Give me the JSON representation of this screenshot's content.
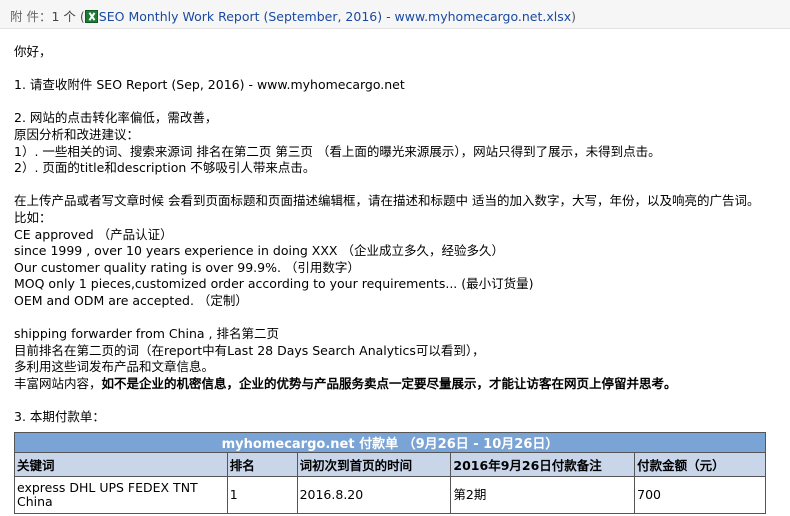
{
  "attachment": {
    "label": "附  件：",
    "count": "1 个",
    "open_paren": "(",
    "file_name": "SEO Monthly Work Report (September, 2016) - www.myhomecargo.net.xlsx",
    "close_paren": ")",
    "icon": "excel-icon"
  },
  "lines": [
    "你好，",
    "",
    "1. 请查收附件  SEO Report (Sep, 2016) - www.myhomecargo.net",
    "",
    "2.  网站的点击转化率偏低，需改善，",
    "原因分析和改进建议：",
    "1）.  一些相关的词、搜索来源词 排名在第二页 第三页 （看上面的曝光来源展示），网站只得到了展示，未得到点击。",
    "2）.  页面的title和description  不够吸引人带来点击。",
    "",
    "在上传产品或者写文章时候 会看到页面标题和页面描述编辑框，请在描述和标题中 适当的加入数字，大写，年份，以及响亮的广告词。",
    "比如：",
    "CE approved （产品认证）",
    "since 1999 , over 10 years experience in doing XXX （企业成立多久，经验多久）",
    "Our customer quality rating is over 99.9%.  （引用数字）",
    "MOQ only 1 pieces,customized order according to your requirements... (最小订货量)",
    "OEM and ODM are accepted.  （定制）",
    "",
    "shipping forwarder from China , 排名第二页",
    "目前排名在第二页的词（在report中有Last 28 Days Search Analytics可以看到），",
    "多利用这些词发布产品和文章信息。"
  ],
  "rich_line": {
    "prefix": "丰富网站内容，",
    "bold": "如不是企业的机密信息，企业的优势与产品服务卖点一定要尽量展示，才能让访客在网页上停留并思考。"
  },
  "section3": "3.  本期付款单：",
  "payment_table": {
    "title": "myhomecargo.net 付款单 （9月26日 - 10月26日）",
    "headers": [
      "关键词",
      "排名",
      "词初次到首页的时间",
      "2016年9月26日付款备注",
      "付款金额（元）"
    ],
    "rows": [
      [
        "express DHL UPS FEDEX TNT China",
        "1",
        "2016.8.20",
        "第2期",
        "700"
      ]
    ]
  }
}
